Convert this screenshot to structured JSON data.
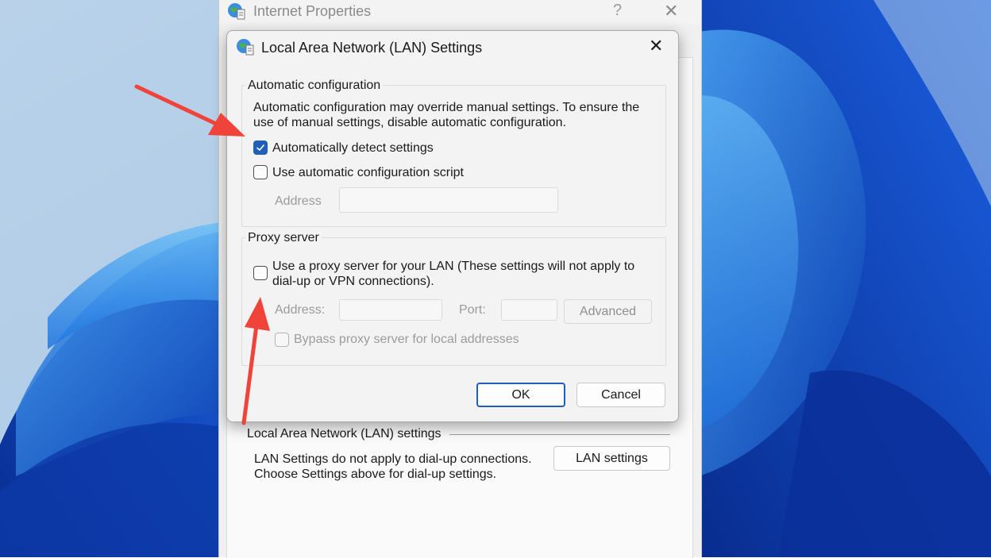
{
  "internet_properties": {
    "title": "Internet Properties",
    "help": "?",
    "close": "✕",
    "lan_section": {
      "title": "Local Area Network (LAN) settings",
      "description": "LAN Settings do not apply to dial-up connections.\nChoose Settings above for dial-up settings.",
      "button": "LAN settings"
    }
  },
  "lan_dialog": {
    "title": "Local Area Network (LAN) Settings",
    "close": "✕",
    "auto_config": {
      "legend": "Automatic configuration",
      "description": "Automatic configuration may override manual settings.  To ensure the\nuse of manual settings, disable automatic configuration.",
      "auto_detect": {
        "label": "Automatically detect settings",
        "checked": true
      },
      "auto_script": {
        "label": "Use automatic configuration script",
        "checked": false
      },
      "address_label": "Address",
      "address_value": ""
    },
    "proxy": {
      "legend": "Proxy server",
      "use_proxy": {
        "label": "Use a proxy server for your LAN (These settings will not apply to\ndial-up or VPN connections).",
        "checked": false
      },
      "address_label": "Address:",
      "address_value": "",
      "port_label": "Port:",
      "port_value": "",
      "advanced_button": "Advanced",
      "bypass": {
        "label": "Bypass proxy server for local addresses",
        "checked": false
      }
    },
    "ok_button": "OK",
    "cancel_button": "Cancel"
  },
  "colors": {
    "accent": "#1f5fb8",
    "annotation_arrow": "#f0433a"
  }
}
